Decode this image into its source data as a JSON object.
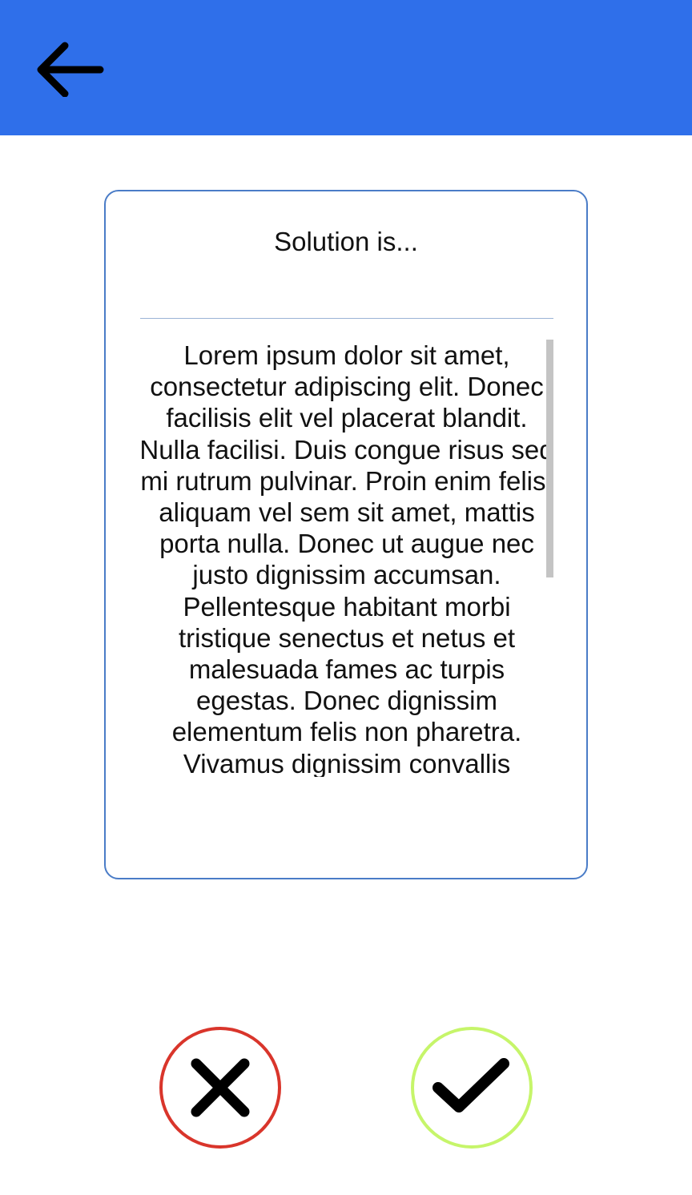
{
  "app_bar": {
    "color": "#2f6fea",
    "back_icon": "arrow-left-icon"
  },
  "card": {
    "title": "Solution is...",
    "body": "Lorem ipsum dolor sit amet, consectetur adipiscing elit. Donec facilisis elit vel placerat blandit. Nulla facilisi. Duis congue risus sed mi rutrum pulvinar. Proin enim felis, aliquam vel sem sit amet, mattis porta nulla. Donec ut augue nec justo dignissim accumsan. Pellentesque habitant morbi tristique senectus et netus et malesuada fames ac turpis egestas. Donec dignissim elementum felis non pharetra. Vivamus dignissim convallis",
    "border_color": "#4a7cc7"
  },
  "actions": {
    "reject": {
      "icon": "close-icon",
      "color": "#d9352b"
    },
    "accept": {
      "icon": "check-icon",
      "color": "#c6f56a"
    }
  }
}
